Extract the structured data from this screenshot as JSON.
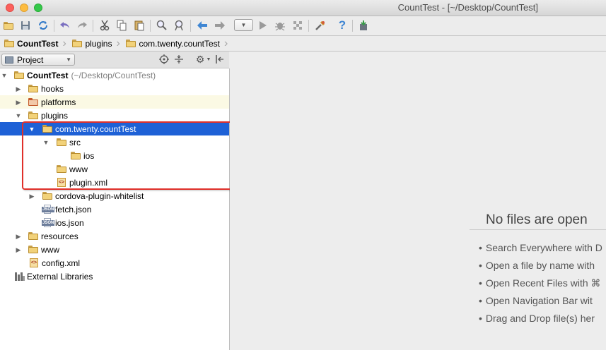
{
  "window": {
    "title": "CountTest - [~/Desktop/CountTest]"
  },
  "toolbar": {
    "icons": [
      "open-folder-icon",
      "save-icon",
      "sync-icon",
      "undo-icon",
      "redo-icon",
      "cut-icon",
      "copy-icon",
      "paste-icon",
      "find-icon",
      "replace-icon",
      "back-icon",
      "forward-icon",
      "run-config-dropdown",
      "run-icon",
      "debug-icon",
      "profile-icon",
      "settings-icon",
      "help-icon",
      "sdk-manager-icon"
    ]
  },
  "breadcrumb": {
    "items": [
      "CountTest",
      "plugins",
      "com.twenty.countTest"
    ]
  },
  "project_panel": {
    "view_label": "Project"
  },
  "tree": {
    "root_label": "CountTest",
    "root_path": "(~/Desktop/CountTest)",
    "items": [
      {
        "label": "hooks"
      },
      {
        "label": "platforms"
      },
      {
        "label": "plugins"
      },
      {
        "label": "com.twenty.countTest"
      },
      {
        "label": "src"
      },
      {
        "label": "ios"
      },
      {
        "label": "www"
      },
      {
        "label": "plugin.xml"
      },
      {
        "label": "cordova-plugin-whitelist"
      },
      {
        "label": "fetch.json"
      },
      {
        "label": "ios.json"
      },
      {
        "label": "resources"
      },
      {
        "label": "www"
      },
      {
        "label": "config.xml"
      },
      {
        "label": "External Libraries"
      }
    ]
  },
  "editor": {
    "empty_title": "No files are open",
    "hints": [
      "Search Everywhere with D",
      "Open a file by name with",
      "Open Recent Files with ⌘",
      "Open Navigation Bar wit",
      "Drag and Drop file(s) her"
    ]
  },
  "colors": {
    "selection": "#1e61d6",
    "annotation_box": "#e0302a"
  }
}
